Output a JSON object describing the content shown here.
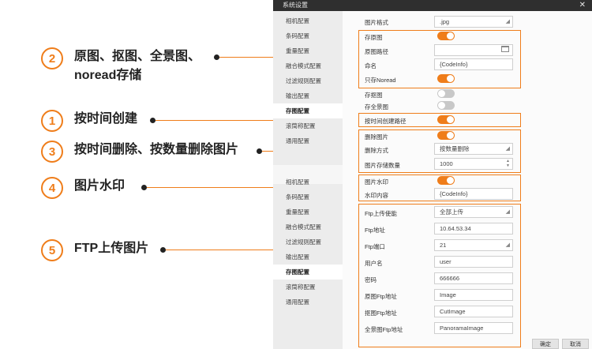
{
  "annotations": [
    {
      "num": "2",
      "lines": [
        "原图、抠图、全景图、",
        "noread存储"
      ]
    },
    {
      "num": "1",
      "lines": [
        "按时间创建"
      ]
    },
    {
      "num": "3",
      "lines": [
        "按时间删除、按数量删除图片"
      ]
    },
    {
      "num": "4",
      "lines": [
        "图片水印"
      ]
    },
    {
      "num": "5",
      "lines": [
        "FTP上传图片"
      ]
    }
  ],
  "window": {
    "title": "系统设置",
    "close": "✕"
  },
  "sidebar": {
    "upper": [
      "相机配置",
      "条码配置",
      "重量配置",
      "融合模式配置",
      "过滤规则配置",
      "输出配置",
      "存图配置",
      "滚筒称配置",
      "通用配置"
    ],
    "lower": [
      "相机配置",
      "条码配置",
      "重量配置",
      "融合模式配置",
      "过滤规则配置",
      "输出配置",
      "存图配置",
      "滚筒称配置",
      "通用配置"
    ]
  },
  "settings": {
    "image_format": {
      "label": "图片格式",
      "value": ".jpg"
    },
    "save_original": {
      "label": "存原图",
      "on": true
    },
    "original_path": {
      "label": "原图路径",
      "value": ""
    },
    "naming": {
      "label": "命名",
      "value": "{CodeInfo}"
    },
    "save_noread_only": {
      "label": "只存Noread",
      "on": true
    },
    "save_cutout": {
      "label": "存抠图",
      "on": false
    },
    "save_panorama": {
      "label": "存全景图",
      "on": false
    },
    "time_path": {
      "label": "按时间创建路径",
      "on": true
    },
    "delete_images": {
      "label": "删除图片",
      "on": true
    },
    "delete_mode": {
      "label": "删除方式",
      "value": "按数量删除"
    },
    "image_count": {
      "label": "图片存储数量",
      "value": "1000"
    },
    "watermark": {
      "label": "图片水印",
      "on": true
    },
    "watermark_content": {
      "label": "水印内容",
      "value": "{CodeInfo}"
    },
    "ftp_enable": {
      "label": "Ftp上传使能",
      "value": "全部上传"
    },
    "ftp_address": {
      "label": "Ftp地址",
      "value": "10.64.53.34"
    },
    "ftp_port": {
      "label": "Ftp端口",
      "value": "21"
    },
    "username": {
      "label": "用户名",
      "value": "user"
    },
    "password": {
      "label": "密码",
      "value": "666666"
    },
    "orig_ftp": {
      "label": "原图Ftp地址",
      "value": "Image"
    },
    "cut_ftp": {
      "label": "抠图Ftp地址",
      "value": "CutImage"
    },
    "pano_ftp": {
      "label": "全景图Ftp地址",
      "value": "PanoramaImage"
    }
  },
  "buttons": {
    "ok": "确定",
    "cancel": "取消"
  },
  "colors": {
    "accent": "#ef7d1a",
    "titlebar": "#2f2f2f"
  }
}
